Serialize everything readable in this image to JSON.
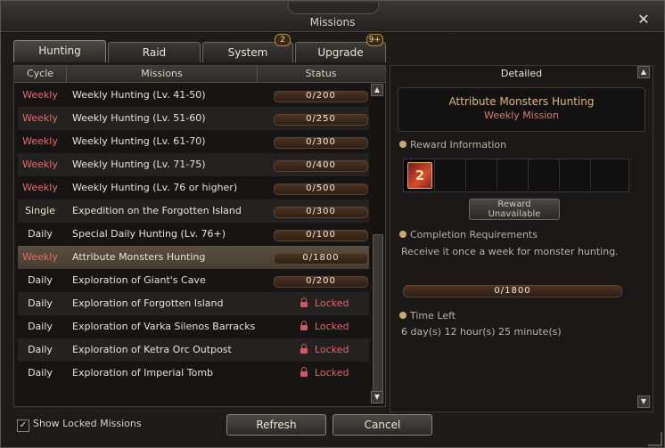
{
  "window": {
    "title": "Missions"
  },
  "tabs": [
    {
      "label": "Hunting",
      "badge": ""
    },
    {
      "label": "Raid",
      "badge": ""
    },
    {
      "label": "System",
      "badge": "2"
    },
    {
      "label": "Upgrade",
      "badge": "9+"
    }
  ],
  "table": {
    "headers": [
      "Cycle",
      "Missions",
      "Status"
    ],
    "rows": [
      {
        "cycle": "Weekly",
        "mission": "Weekly Hunting (Lv. 41-50)",
        "status": "0/200",
        "locked": false
      },
      {
        "cycle": "Weekly",
        "mission": "Weekly Hunting (Lv. 51-60)",
        "status": "0/250",
        "locked": false
      },
      {
        "cycle": "Weekly",
        "mission": "Weekly Hunting (Lv. 61-70)",
        "status": "0/300",
        "locked": false
      },
      {
        "cycle": "Weekly",
        "mission": "Weekly Hunting (Lv. 71-75)",
        "status": "0/400",
        "locked": false
      },
      {
        "cycle": "Weekly",
        "mission": "Weekly Hunting (Lv. 76 or higher)",
        "status": "0/500",
        "locked": false
      },
      {
        "cycle": "Single",
        "mission": "Expedition on the Forgotten Island",
        "status": "0/300",
        "locked": false
      },
      {
        "cycle": "Daily",
        "mission": "Special Daily Hunting (Lv. 76+)",
        "status": "0/100",
        "locked": false
      },
      {
        "cycle": "Weekly",
        "mission": "Attribute Monsters Hunting",
        "status": "0/1800",
        "locked": false
      },
      {
        "cycle": "Daily",
        "mission": "Exploration of Giant's Cave",
        "status": "0/200",
        "locked": false
      },
      {
        "cycle": "Daily",
        "mission": "Exploration of Forgotten Island",
        "status": "Locked",
        "locked": true
      },
      {
        "cycle": "Daily",
        "mission": "Exploration of Varka Silenos Barracks",
        "status": "Locked",
        "locked": true
      },
      {
        "cycle": "Daily",
        "mission": "Exploration of Ketra Orc Outpost",
        "status": "Locked",
        "locked": true
      },
      {
        "cycle": "Daily",
        "mission": "Exploration of Imperial Tomb",
        "status": "Locked",
        "locked": true
      }
    ]
  },
  "detail": {
    "header": "Detailed",
    "mission_name": "Attribute Monsters Hunting",
    "mission_type": "Weekly Mission",
    "reward_section": "Reward Information",
    "reward_item_glyph": "2",
    "reward_button_line1": "Reward",
    "reward_button_line2": "Unavailable",
    "completion_section": "Completion Requirements",
    "completion_desc": "Receive it once a week for monster hunting.",
    "progress": "0/1800",
    "timeleft_section": "Time Left",
    "timeleft_value": "6 day(s) 12 hour(s) 25 minute(s)"
  },
  "footer": {
    "show_locked_label": "Show Locked Missions",
    "show_locked_checked": "✓",
    "refresh_label": "Refresh",
    "cancel_label": "Cancel"
  },
  "colors": {
    "weekly": "#e86a6a",
    "single": "#e8e0c0",
    "daily": "#e8e4d6",
    "locked": "#e7606a",
    "accent_title": "#e8b86a"
  },
  "icons": {
    "close": "close-icon",
    "lock": "lock-icon",
    "scroll_up": "arrow-up-icon",
    "scroll_down": "arrow-down-icon",
    "reward": "reward-icon",
    "completion": "scroll-icon",
    "time": "clock-icon"
  }
}
